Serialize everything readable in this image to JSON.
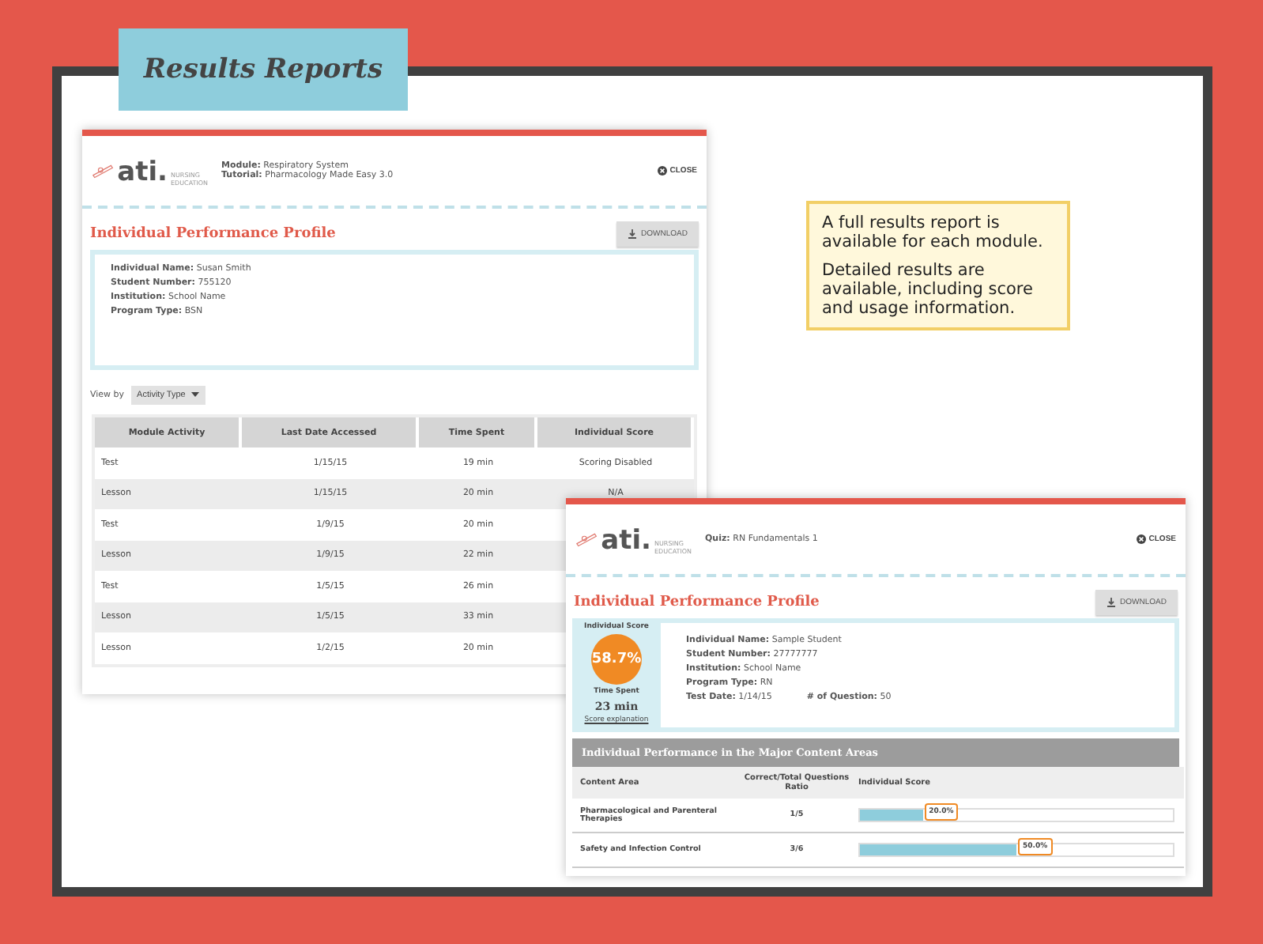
{
  "title_tag": "Results Reports",
  "callout": [
    "A full results report is available for each module.",
    "Detailed results are available, including score and usage information."
  ],
  "report_module": {
    "logo": {
      "mark": "ati.",
      "sub": "NURSING EDUCATION"
    },
    "meta": [
      {
        "label": "Module:",
        "value": "Respiratory System"
      },
      {
        "label": "Tutorial:",
        "value": "Pharmacology Made Easy 3.0"
      }
    ],
    "close": "CLOSE",
    "heading": "Individual Performance Profile",
    "download": "DOWNLOAD",
    "info": [
      {
        "label": "Individual Name:",
        "value": "Susan Smith"
      },
      {
        "label": "Student Number:",
        "value": "755120"
      },
      {
        "label": "Institution:",
        "value": "School Name"
      },
      {
        "label": "Program Type:",
        "value": "BSN"
      }
    ],
    "view_by": {
      "label": "View by",
      "value": "Activity Type"
    },
    "columns": [
      "Module Activity",
      "Last Date Accessed",
      "Time Spent",
      "Individual Score"
    ],
    "rows": [
      {
        "activity": "Test",
        "date": "1/15/15",
        "time": "19 min",
        "score": "Scoring Disabled"
      },
      {
        "activity": "Lesson",
        "date": "1/15/15",
        "time": "20 min",
        "score": "N/A"
      },
      {
        "activity": "Test",
        "date": "1/9/15",
        "time": "20 min"
      },
      {
        "activity": "Lesson",
        "date": "1/9/15",
        "time": "22 min"
      },
      {
        "activity": "Test",
        "date": "1/5/15",
        "time": "26 min"
      },
      {
        "activity": "Lesson",
        "date": "1/5/15",
        "time": "33 min"
      },
      {
        "activity": "Lesson",
        "date": "1/2/15",
        "time": "20 min"
      }
    ]
  },
  "report_quiz": {
    "logo": {
      "mark": "ati.",
      "sub": "NURSING EDUCATION"
    },
    "meta": [
      {
        "label": "Quiz:",
        "value": "RN Fundamentals 1"
      }
    ],
    "close": "CLOSE",
    "heading": "Individual Performance Profile",
    "download": "DOWNLOAD",
    "score": {
      "label": "Individual Score",
      "value": "58.7%",
      "time_label": "Time Spent",
      "time": "23 min",
      "link": "Score explanation"
    },
    "info": [
      {
        "label": "Individual Name:",
        "value": "Sample Student"
      },
      {
        "label": "Student Number:",
        "value": "27777777"
      },
      {
        "label": "Institution:",
        "value": "School Name"
      },
      {
        "label": "Program Type:",
        "value": "RN"
      }
    ],
    "info_last": [
      {
        "label": "Test Date:",
        "value": "1/14/15"
      },
      {
        "label": "# of Question:",
        "value": "50"
      }
    ],
    "section": "Individual Performance in the Major Content Areas",
    "columns": [
      "Content Area",
      "Correct/Total Questions Ratio",
      "Individual Score"
    ],
    "rows": [
      {
        "area": "Pharmacological and Parenteral Therapies",
        "ratio": "1/5",
        "score": "20.0%",
        "level": 0.2
      },
      {
        "area": "Safety and Infection Control",
        "ratio": "3/6",
        "score": "50.0%",
        "level": 0.5
      }
    ]
  }
}
